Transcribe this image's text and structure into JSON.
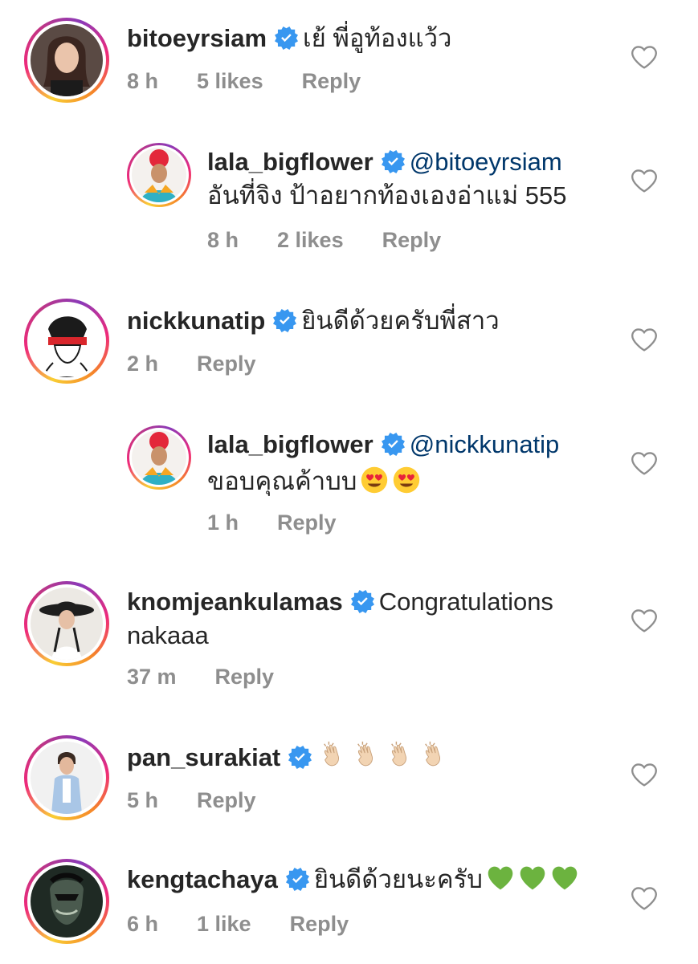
{
  "comments": [
    {
      "username": "bitoeyrsiam",
      "text": "เย้ พี่อูท้องแว้ว",
      "time": "8 h",
      "likes": "5 likes",
      "reply": "Reply"
    },
    {
      "username": "lala_bigflower",
      "mention": "@bitoeyrsiam",
      "text": "อันที่จิง ป้าอยากท้องเองอ่าแม่ 555",
      "time": "8 h",
      "likes": "2 likes",
      "reply": "Reply"
    },
    {
      "username": "nickkunatip",
      "text": "ยินดีด้วยครับพี่สาว",
      "time": "2 h",
      "reply": "Reply"
    },
    {
      "username": "lala_bigflower",
      "mention": "@nickkunatip",
      "text": "ขอบคุณค้าบบ",
      "emoji": "heart-eyes x2",
      "time": "1 h",
      "reply": "Reply"
    },
    {
      "username": "knomjeankulamas",
      "text": "Congratulations",
      "text_cont": "nakaaa",
      "time": "37 m",
      "reply": "Reply"
    },
    {
      "username": "pan_surakiat",
      "emoji": "clapping-hands x4",
      "time": "5 h",
      "reply": "Reply"
    },
    {
      "username": "kengtachaya",
      "text": "ยินดีด้วยนะครับ",
      "emoji": "green-heart x3",
      "time": "6 h",
      "likes": "1 like",
      "reply": "Reply"
    }
  ],
  "colors": {
    "text": "#262626",
    "secondary": "#8e8e8e",
    "verified": "#3897f0",
    "mention": "#00376b"
  }
}
